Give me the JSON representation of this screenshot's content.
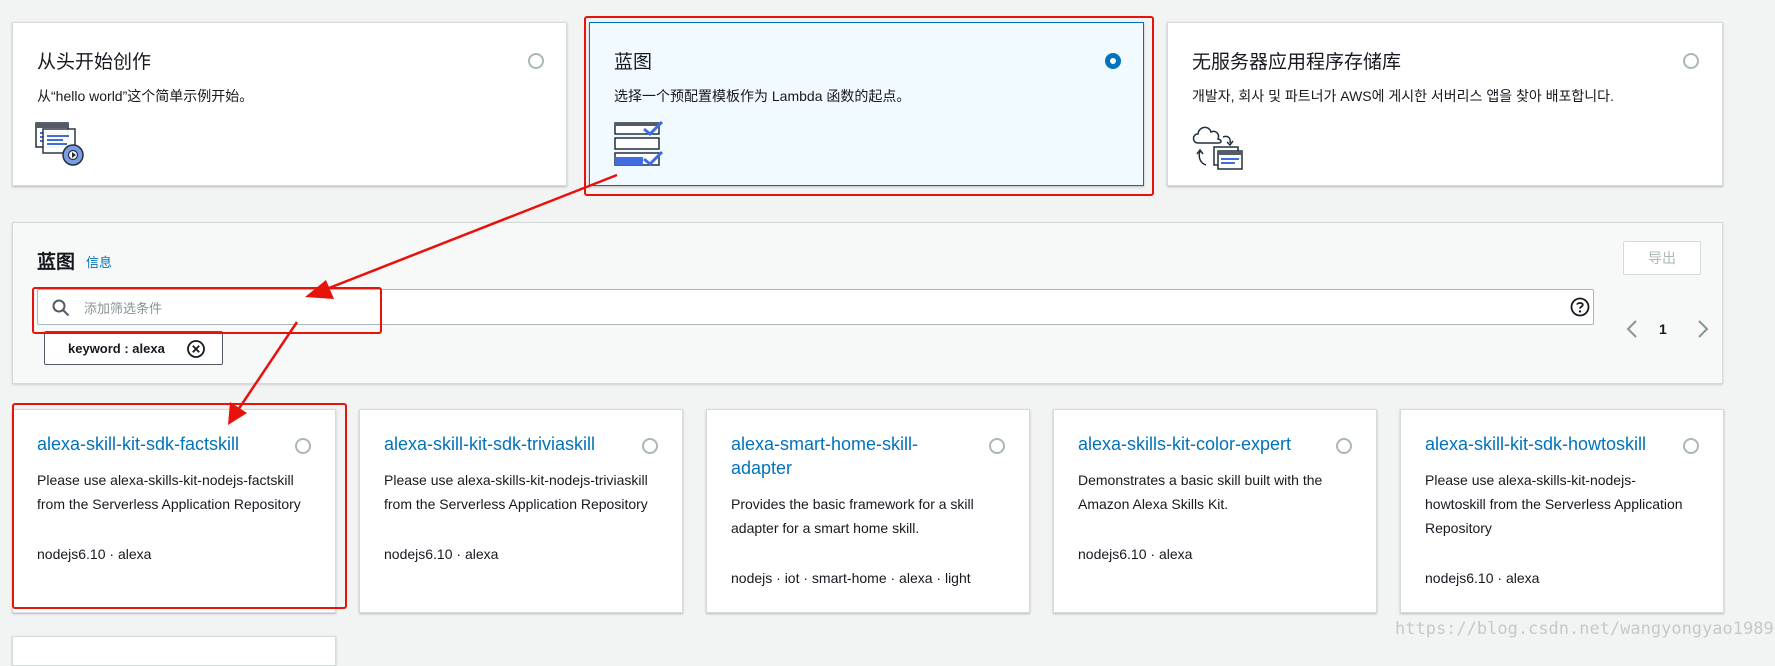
{
  "create_options": [
    {
      "title": "从头开始创作",
      "description": "从“hello world”这个简单示例开始。",
      "selected": false
    },
    {
      "title": "蓝图",
      "description": "选择一个预配置模板作为 Lambda 函数的起点。",
      "selected": true
    },
    {
      "title": "无服务器应用程序存储库",
      "description": "개발자, 회사 및 파트너가 AWS에 게시한 서버리스 앱을 찾아 배포합니다.",
      "selected": false
    }
  ],
  "blueprints_panel": {
    "title": "蓝图",
    "info_link": "信息",
    "export_button": "导出",
    "filter_placeholder": "添加筛选条件",
    "filter_token": "keyword : alexa",
    "page_number": "1"
  },
  "blueprints": [
    {
      "title": "alexa-skill-kit-sdk-factskill",
      "description": "Please use alexa-skills-kit-nodejs-factskill from the Serverless Application Repository",
      "tags": "nodejs6.10 · alexa"
    },
    {
      "title": "alexa-skill-kit-sdk-triviaskill",
      "description": "Please use alexa-skills-kit-nodejs-triviaskill from the Serverless Application Repository",
      "tags": "nodejs6.10 · alexa"
    },
    {
      "title": "alexa-smart-home-skill-adapter",
      "description": "Provides the basic framework for a skill adapter for a smart home skill.",
      "tags": "nodejs · iot · smart-home · alexa · light"
    },
    {
      "title": "alexa-skills-kit-color-expert",
      "description": "Demonstrates a basic skill built with the Amazon Alexa Skills Kit.",
      "tags": "nodejs6.10 · alexa"
    },
    {
      "title": "alexa-skill-kit-sdk-howtoskill",
      "description": "Please use alexa-skills-kit-nodejs-howtoskill from the Serverless Application Repository",
      "tags": "nodejs6.10 · alexa"
    }
  ],
  "watermark": "https://blog.csdn.net/wangyongyao1989",
  "colors": {
    "accent": "#0073bb",
    "annotation": "#e8120c",
    "background": "#f2f3f3"
  }
}
